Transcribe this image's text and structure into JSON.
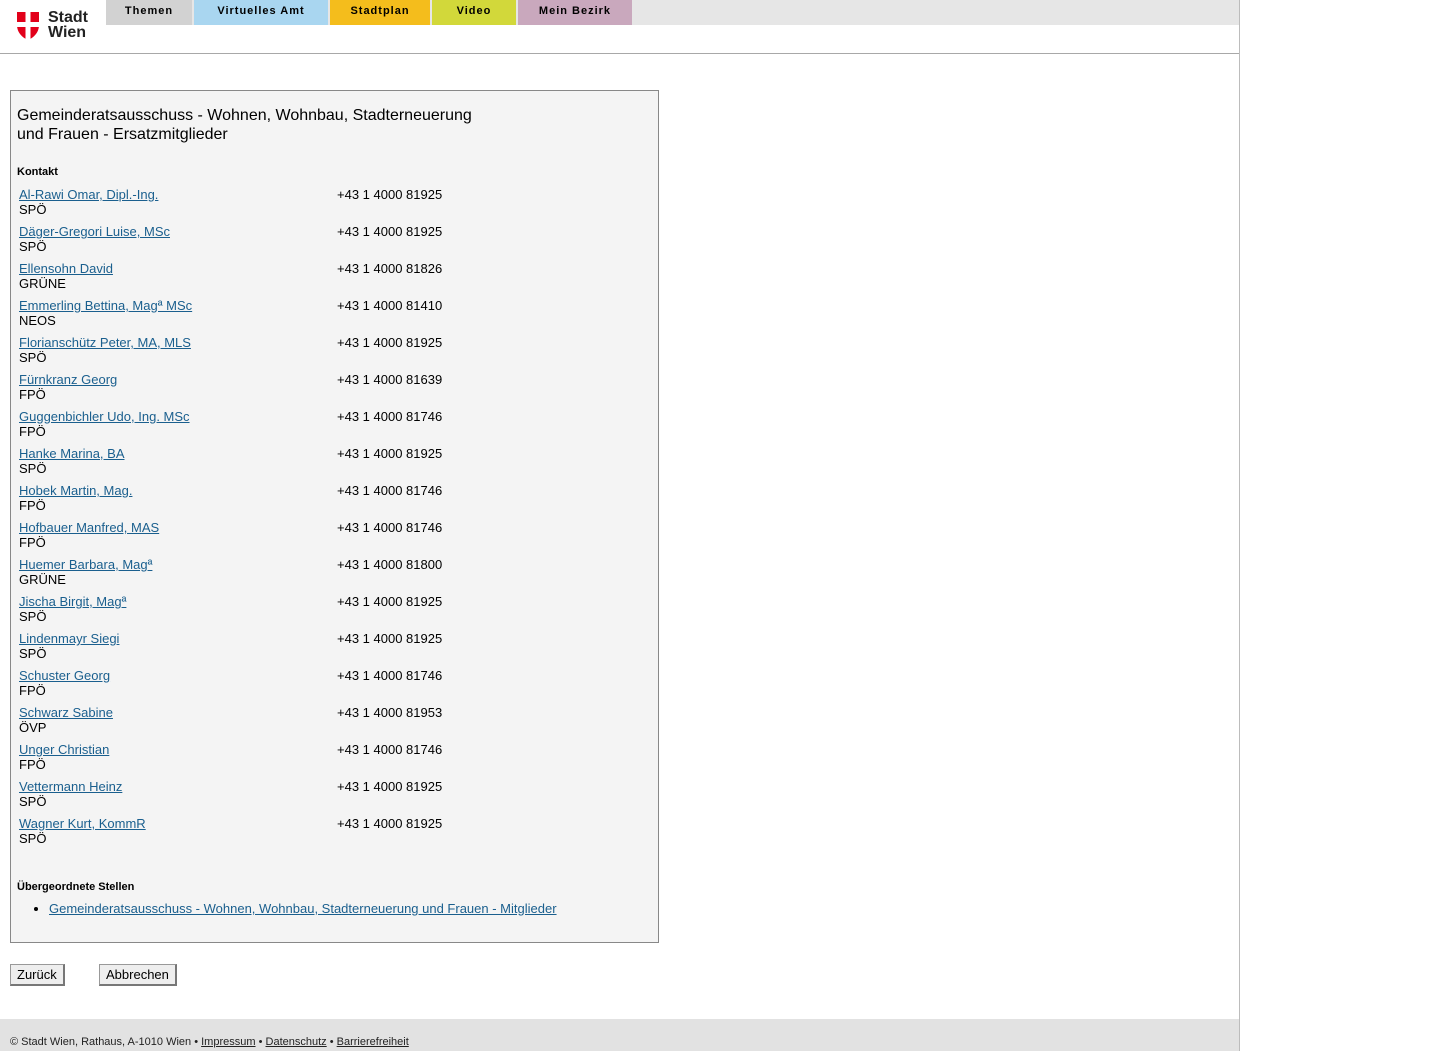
{
  "header": {
    "logo_line1": "Stadt",
    "logo_line2": "Wien",
    "tabs": [
      {
        "label": "Themen",
        "color": "#d2d2d2"
      },
      {
        "label": "Virtuelles Amt",
        "color": "#a9d6f0"
      },
      {
        "label": "Stadtplan",
        "color": "#f4bd1c"
      },
      {
        "label": "Video",
        "color": "#d2d83a"
      },
      {
        "label": "Mein Bezirk",
        "color": "#c9a8bd"
      }
    ]
  },
  "main": {
    "title_line1": "Gemeinderatsausschuss - Wohnen, Wohnbau, Stadterneuerung",
    "title_line2": "und Frauen - Ersatzmitglieder",
    "contact_label": "Kontakt",
    "members": [
      {
        "name": "Al-Rawi Omar, Dipl.-Ing.",
        "party": "SPÖ",
        "phone": "+43 1 4000 81925"
      },
      {
        "name": "Däger-Gregori Luise, MSc",
        "party": "SPÖ",
        "phone": "+43 1 4000 81925"
      },
      {
        "name": "Ellensohn David",
        "party": "GRÜNE",
        "phone": "+43 1 4000 81826"
      },
      {
        "name": "Emmerling Bettina, Magª MSc",
        "party": "NEOS",
        "phone": "+43 1 4000 81410"
      },
      {
        "name": "Florianschütz Peter, MA, MLS",
        "party": "SPÖ",
        "phone": "+43 1 4000 81925"
      },
      {
        "name": "Fürnkranz Georg",
        "party": "FPÖ",
        "phone": "+43 1 4000 81639"
      },
      {
        "name": "Guggenbichler Udo, Ing. MSc",
        "party": "FPÖ",
        "phone": "+43 1 4000 81746"
      },
      {
        "name": "Hanke Marina, BA",
        "party": "SPÖ",
        "phone": "+43 1 4000 81925"
      },
      {
        "name": "Hobek Martin, Mag.",
        "party": "FPÖ",
        "phone": "+43 1 4000 81746"
      },
      {
        "name": "Hofbauer Manfred, MAS",
        "party": "FPÖ",
        "phone": "+43 1 4000 81746"
      },
      {
        "name": "Huemer Barbara, Magª",
        "party": "GRÜNE",
        "phone": "+43 1 4000 81800"
      },
      {
        "name": "Jischa Birgit, Magª",
        "party": "SPÖ",
        "phone": "+43 1 4000 81925"
      },
      {
        "name": "Lindenmayr Siegi",
        "party": "SPÖ",
        "phone": "+43 1 4000 81925"
      },
      {
        "name": "Schuster Georg",
        "party": "FPÖ",
        "phone": "+43 1 4000 81746"
      },
      {
        "name": "Schwarz Sabine",
        "party": "ÖVP",
        "phone": "+43 1 4000 81953"
      },
      {
        "name": "Unger Christian",
        "party": "FPÖ",
        "phone": "+43 1 4000 81746"
      },
      {
        "name": "Vettermann Heinz",
        "party": "SPÖ",
        "phone": "+43 1 4000 81925"
      },
      {
        "name": "Wagner Kurt, KommR",
        "party": "SPÖ",
        "phone": "+43 1 4000 81925"
      }
    ],
    "parent_label": "Übergeordnete Stellen",
    "parent_link": "Gemeinderatsausschuss - Wohnen, Wohnbau, Stadterneuerung und Frauen - Mitglieder"
  },
  "actions": {
    "back_label": "Zurück",
    "cancel_label": "Abbrechen"
  },
  "footer": {
    "copyright": "© Stadt Wien, Rathaus, A-1010 Wien •",
    "sep": "•",
    "impressum": "Impressum",
    "datenschutz": "Datenschutz",
    "barrierefreiheit": "Barrierefreiheit"
  }
}
